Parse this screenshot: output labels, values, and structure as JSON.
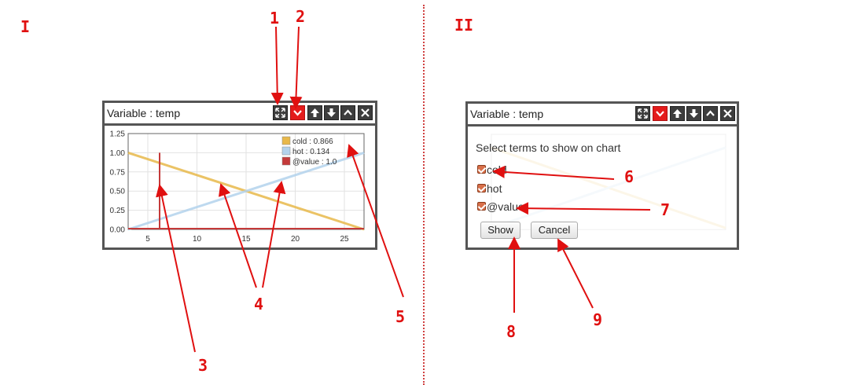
{
  "sections": {
    "left": "I",
    "right": "II"
  },
  "annotations": {
    "n1": "1",
    "n2": "2",
    "n3": "3",
    "n4": "4",
    "n5": "5",
    "n6": "6",
    "n7": "7",
    "n8": "8",
    "n9": "9"
  },
  "widget": {
    "title": "Variable : temp",
    "toolbar": [
      {
        "name": "maximize-button",
        "icon": "maximize-icon"
      },
      {
        "name": "collapse-button",
        "icon": "chevron-down-icon"
      },
      {
        "name": "move-up-button",
        "icon": "arrow-up-icon"
      },
      {
        "name": "move-down-button",
        "icon": "arrow-down-icon"
      },
      {
        "name": "minimize-button",
        "icon": "chevron-up-icon"
      },
      {
        "name": "close-button",
        "icon": "close-icon"
      }
    ]
  },
  "chart_data": {
    "type": "line",
    "x_ticks": [
      5,
      10,
      15,
      20,
      25
    ],
    "y_ticks": [
      "0.00",
      "0.25",
      "0.50",
      "0.75",
      "1.00",
      "1.25"
    ],
    "xlim": [
      3,
      27
    ],
    "ylim": [
      0,
      1.25
    ],
    "grid": true,
    "legend_position": "top-right",
    "series": [
      {
        "name": "cold",
        "legend_text": "cold : 0.866",
        "color": "#e8b84a",
        "x": [
          3,
          27
        ],
        "y": [
          1.0,
          0.0
        ]
      },
      {
        "name": "hot",
        "legend_text": "hot : 0.134",
        "color": "#b3d2ec",
        "x": [
          3,
          27
        ],
        "y": [
          0.0,
          1.0
        ]
      },
      {
        "name": "@value",
        "legend_text": "@value : 1.0",
        "color": "#c43a3a",
        "x": [
          6.2,
          6.2
        ],
        "y": [
          0.0,
          1.0
        ]
      }
    ]
  },
  "dialog": {
    "heading": "Select terms to show on chart",
    "terms": [
      "cold",
      "hot",
      "@value"
    ],
    "show_label": "Show",
    "cancel_label": "Cancel"
  }
}
